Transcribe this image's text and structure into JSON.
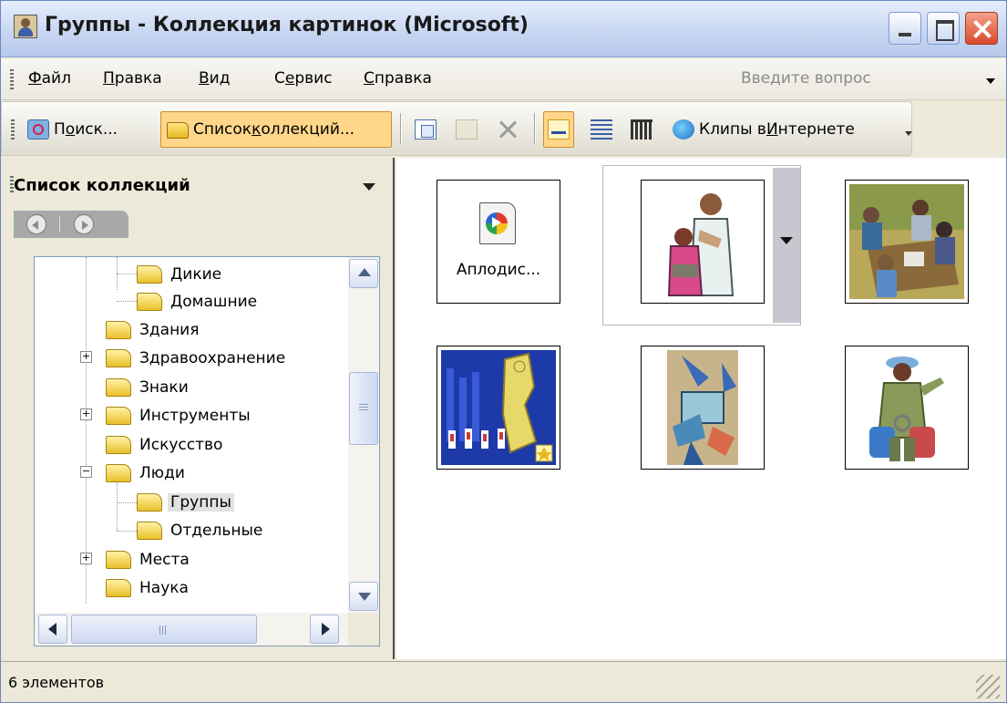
{
  "window": {
    "title": "Группы - Коллекция картинок (Microsoft)"
  },
  "menu": {
    "items": [
      {
        "prefix": "",
        "underline": "Ф",
        "rest": "айл"
      },
      {
        "prefix": "",
        "underline": "П",
        "rest": "равка"
      },
      {
        "prefix": "",
        "underline": "В",
        "rest": "ид"
      },
      {
        "prefix": "С",
        "underline": "е",
        "rest": "рвис"
      },
      {
        "prefix": "",
        "underline": "С",
        "rest": "правка"
      }
    ],
    "ask_placeholder": "Введите вопрос"
  },
  "toolbar": {
    "search_prefix": "П",
    "search_underline": "о",
    "search_rest": "иск...",
    "collections_prefix": "Список ",
    "collections_underline": "к",
    "collections_rest": "оллекций...",
    "clips_online_prefix": "Клипы в ",
    "clips_online_underline": "И",
    "clips_online_rest": "нтернете"
  },
  "task_pane": {
    "title": "Список коллекций",
    "tree": [
      {
        "label": "Дикие"
      },
      {
        "label": "Домашние"
      },
      {
        "label": "Здания"
      },
      {
        "label": "Здравоохранение"
      },
      {
        "label": "Знаки"
      },
      {
        "label": "Инструменты"
      },
      {
        "label": "Искусство"
      },
      {
        "label": "Люди"
      },
      {
        "label": "Группы"
      },
      {
        "label": "Отдельные"
      },
      {
        "label": "Места"
      },
      {
        "label": "Наука"
      }
    ]
  },
  "clips": [
    {
      "label": "Аплодис..."
    }
  ],
  "status": {
    "text": "6 элементов"
  },
  "colors": {
    "titlebar": "#c8d7f2",
    "selected_button": "#ffd68a",
    "pane_background": "#ece9d8"
  }
}
